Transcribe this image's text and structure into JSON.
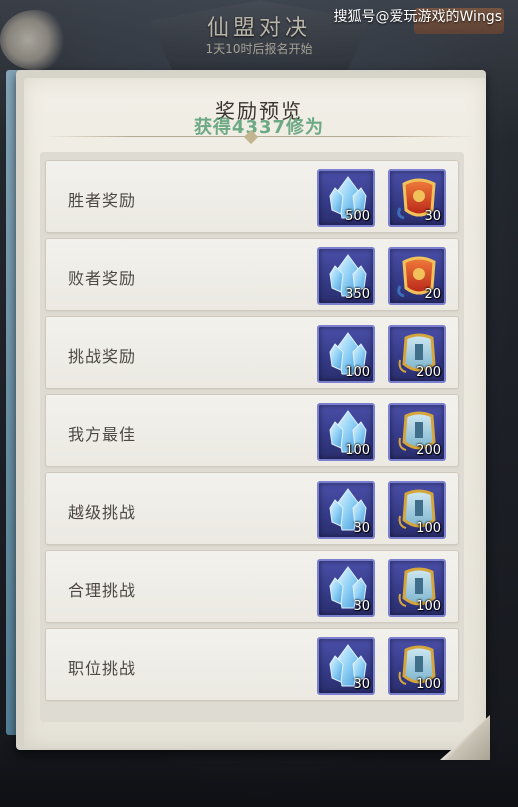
{
  "header": {
    "title": "仙盟对决",
    "subtitle": "1天10时后报名开始"
  },
  "watermark": "搜狐号@爱玩游戏的Wings",
  "panel": {
    "title": "奖励预览",
    "overlay_text": "获得4337修为"
  },
  "rewards": [
    {
      "label": "胜者奖励",
      "items": [
        {
          "icon": "blue-crystal-icon",
          "qty": "500"
        },
        {
          "icon": "red-gold-token-icon",
          "qty": "30"
        }
      ]
    },
    {
      "label": "败者奖励",
      "items": [
        {
          "icon": "blue-crystal-icon",
          "qty": "350"
        },
        {
          "icon": "red-gold-token-icon",
          "qty": "20"
        }
      ]
    },
    {
      "label": "挑战奖励",
      "items": [
        {
          "icon": "blue-crystal-icon",
          "qty": "100"
        },
        {
          "icon": "blue-gold-token-icon",
          "qty": "200"
        }
      ]
    },
    {
      "label": "我方最佳",
      "items": [
        {
          "icon": "blue-crystal-icon",
          "qty": "100"
        },
        {
          "icon": "blue-gold-token-icon",
          "qty": "200"
        }
      ]
    },
    {
      "label": "越级挑战",
      "items": [
        {
          "icon": "blue-crystal-icon",
          "qty": "30"
        },
        {
          "icon": "blue-gold-token-icon",
          "qty": "100"
        }
      ]
    },
    {
      "label": "合理挑战",
      "items": [
        {
          "icon": "blue-crystal-icon",
          "qty": "30"
        },
        {
          "icon": "blue-gold-token-icon",
          "qty": "100"
        }
      ]
    },
    {
      "label": "职位挑战",
      "items": [
        {
          "icon": "blue-crystal-icon",
          "qty": "30"
        },
        {
          "icon": "blue-gold-token-icon",
          "qty": "100"
        }
      ]
    }
  ],
  "colors": {
    "item_frame": "#343a86",
    "paper": "#f1eee6",
    "overlay_text": "#5fa27a"
  }
}
